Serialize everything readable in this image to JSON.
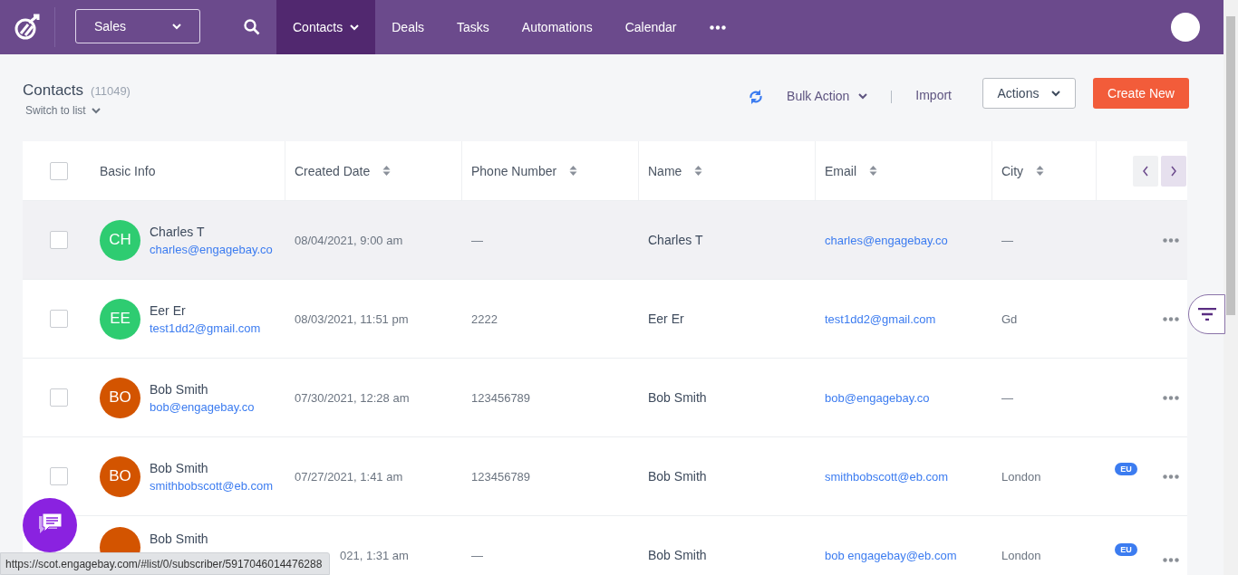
{
  "topbar": {
    "pipeline": "Sales",
    "nav": [
      {
        "label": "Contacts",
        "selected": true,
        "dropdown": true
      },
      {
        "label": "Deals",
        "selected": false,
        "dropdown": false
      },
      {
        "label": "Tasks",
        "selected": false,
        "dropdown": false
      },
      {
        "label": "Automations",
        "selected": false,
        "dropdown": false
      },
      {
        "label": "Calendar",
        "selected": false,
        "dropdown": false
      }
    ]
  },
  "header": {
    "title": "Contacts",
    "count": "(11049)",
    "switch": "Switch to list",
    "bulk_action": "Bulk Action",
    "import": "Import",
    "actions": "Actions",
    "create": "Create New"
  },
  "table": {
    "select_all_checked": false,
    "columns": [
      "Basic Info",
      "Created Date",
      "Phone Number",
      "Name",
      "Email",
      "City"
    ],
    "rows": [
      {
        "checked": false,
        "highlighted": true,
        "initials": "CH",
        "color": "#2ecc71",
        "contact": "Charles T",
        "contact_email": "charles@engagebay.co",
        "created": "08/04/2021, 9:00 am",
        "phone": "—",
        "name": "Charles T",
        "email": "charles@engagebay.co",
        "city": "—"
      },
      {
        "checked": false,
        "highlighted": false,
        "initials": "EE",
        "color": "#2ecc71",
        "contact": "Eer Er",
        "contact_email": "test1dd2@gmail.com",
        "created": "08/03/2021, 11:51 pm",
        "phone": "2222",
        "name": "Eer Er",
        "email": "test1dd2@gmail.com",
        "city": "Gd"
      },
      {
        "checked": false,
        "highlighted": false,
        "initials": "BO",
        "color": "#d35400",
        "contact": "Bob Smith",
        "contact_email": "bob@engagebay.co",
        "created": "07/30/2021, 12:28 am",
        "phone": "123456789",
        "name": "Bob Smith",
        "email": "bob@engagebay.co",
        "city": "—"
      },
      {
        "checked": false,
        "highlighted": false,
        "initials": "BO",
        "color": "#d35400",
        "contact": "Bob Smith",
        "contact_email": "smithbobscott@eb.com",
        "created": "07/27/2021, 1:41 am",
        "phone": "123456789",
        "name": "Bob Smith",
        "email": "smithbobscott@eb.com",
        "city": "London",
        "badge": "EU"
      },
      {
        "highlighted": false,
        "color": "#d35400",
        "contact": "Bob Smith",
        "created": "021, 1:31 am",
        "phone": "—",
        "name": "Bob Smith",
        "email": "bob engagebay@eb.com",
        "city": "London",
        "badge": "EU"
      }
    ]
  },
  "status_url": "https://scot.engagebay.com/#list/0/subscriber/5917046014476288"
}
